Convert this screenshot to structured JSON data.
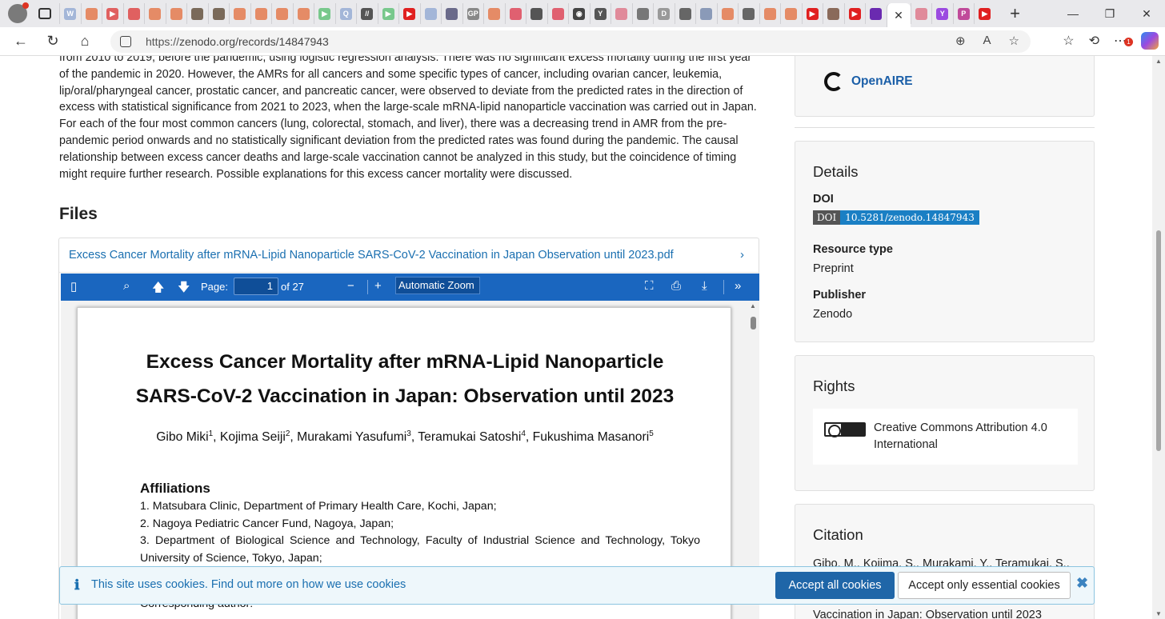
{
  "browser": {
    "tab_favicons": [
      {
        "color": "#a3b6d8",
        "glyph": "W"
      },
      {
        "color": "#e58b66",
        "glyph": ""
      },
      {
        "color": "#e06060",
        "glyph": "▶"
      },
      {
        "color": "#e06060",
        "glyph": ""
      },
      {
        "color": "#e58b66",
        "glyph": ""
      },
      {
        "color": "#e58b66",
        "glyph": ""
      },
      {
        "color": "#7a6a5a",
        "glyph": ""
      },
      {
        "color": "#7a6a5a",
        "glyph": ""
      },
      {
        "color": "#e58b66",
        "glyph": ""
      },
      {
        "color": "#e58b66",
        "glyph": ""
      },
      {
        "color": "#e58b66",
        "glyph": ""
      },
      {
        "color": "#e58b66",
        "glyph": ""
      },
      {
        "color": "#78c88c",
        "glyph": "▶"
      },
      {
        "color": "#a3b6d8",
        "glyph": "Q"
      },
      {
        "color": "#555",
        "glyph": "//"
      },
      {
        "color": "#78c88c",
        "glyph": "▶"
      },
      {
        "color": "#e02020",
        "glyph": "▶"
      },
      {
        "color": "#a3b6d8",
        "glyph": ""
      },
      {
        "color": "#6a6a8a",
        "glyph": ""
      },
      {
        "color": "#888",
        "glyph": "GP"
      },
      {
        "color": "#e58b66",
        "glyph": ""
      },
      {
        "color": "#e06070",
        "glyph": ""
      },
      {
        "color": "#555",
        "glyph": ""
      },
      {
        "color": "#e06070",
        "glyph": ""
      },
      {
        "color": "#444",
        "glyph": "◉"
      },
      {
        "color": "#555",
        "glyph": "Y"
      },
      {
        "color": "#e08a9a",
        "glyph": ""
      },
      {
        "color": "#777",
        "glyph": ""
      },
      {
        "color": "#999",
        "glyph": "D"
      },
      {
        "color": "#666",
        "glyph": ""
      },
      {
        "color": "#8a9ab8",
        "glyph": ""
      },
      {
        "color": "#e58b66",
        "glyph": ""
      },
      {
        "color": "#666",
        "glyph": ""
      },
      {
        "color": "#e58b66",
        "glyph": ""
      },
      {
        "color": "#e58b66",
        "glyph": ""
      },
      {
        "color": "#e02020",
        "glyph": "▶"
      },
      {
        "color": "#8a6a5a",
        "glyph": ""
      },
      {
        "color": "#e02020",
        "glyph": "▶"
      },
      {
        "color": "#6a2ab0",
        "glyph": ""
      }
    ],
    "after_active_favicons": [
      {
        "color": "#e08a9a",
        "glyph": ""
      },
      {
        "color": "#9b4ae0",
        "glyph": "Y"
      },
      {
        "color": "#c04a9a",
        "glyph": "P"
      },
      {
        "color": "#e02020",
        "glyph": "▶"
      }
    ],
    "active_tab_close": "✕",
    "new_tab": "+",
    "url_protocol": "https://",
    "url_rest": "zenodo.org/records/14847943",
    "notification_badge": "1"
  },
  "abstract": {
    "text": "from 2010 to 2019, before the pandemic, using logistic regression analysis. There was no significant excess mortality during the first year of the pandemic in 2020. However, the AMRs for all cancers and some specific types of cancer, including ovarian cancer, leukemia, lip/oral/pharyngeal cancer, prostatic cancer, and pancreatic cancer, were observed to deviate from the predicted rates in the direction of excess with statistical significance from 2021 to 2023, when the large-scale mRNA-lipid nanoparticle vaccination was carried out in Japan. For each of the four most common cancers (lung, colorectal, stomach, and liver), there was a decreasing trend in AMR from the pre-pandemic period onwards and no statistically significant deviation from the predicted rates was found during the pandemic. The causal relationship between excess cancer deaths and large-scale vaccination cannot be analyzed in this study, but the coincidence of timing might require further research. Possible explanations for this excess cancer mortality were discussed."
  },
  "files": {
    "heading": "Files",
    "filename": "Excess Cancer Mortality after mRNA-Lipid Nanoparticle SARS-CoV-2 Vaccination in Japan Observation until 2023.pdf",
    "viewer": {
      "page_label": "Page:",
      "page_value": "1",
      "page_of": "of 27",
      "zoom_value": "Automatic Zoom"
    },
    "pdf": {
      "title_line1": "Excess Cancer Mortality after mRNA-Lipid Nanoparticle",
      "title_line2": "SARS-CoV-2 Vaccination in Japan: Observation until 2023",
      "authors": [
        {
          "name": "Gibo Miki",
          "sup": "1",
          "sep": ", "
        },
        {
          "name": "Kojima Seiji",
          "sup": "2",
          "sep": ", "
        },
        {
          "name": "Murakami Yasufumi",
          "sup": "3",
          "sep": ", "
        },
        {
          "name": "Teramukai Satoshi",
          "sup": "4",
          "sep": ", "
        },
        {
          "name": "Fukushima Masanori",
          "sup": "5",
          "sep": ""
        }
      ],
      "affiliations_heading": "Affiliations",
      "affiliations": [
        "1. Matsubara Clinic, Department of Primary Health Care, Kochi, Japan;",
        "2. Nagoya Pediatric Cancer Fund, Nagoya, Japan;",
        "3. Department of Biological Science and Technology, Faculty of Industrial Science and Technology, Tokyo",
        "University of Science, Tokyo, Japan;"
      ],
      "corresponding": "Corresponding author:"
    }
  },
  "sidebar": {
    "openaire_label": "OpenAIRE",
    "details": {
      "heading": "Details",
      "doi_label": "DOI",
      "doi_badge_left": "DOI",
      "doi_value": "10.5281/zenodo.14847943",
      "resource_type_label": "Resource type",
      "resource_type_value": "Preprint",
      "publisher_label": "Publisher",
      "publisher_value": "Zenodo"
    },
    "rights": {
      "heading": "Rights",
      "license": "Creative Commons Attribution 4.0 International"
    },
    "citation": {
      "heading": "Citation",
      "line1": "Gibo, M., Kojima, S., Murakami, Y., Teramukai, S.,",
      "line_last": "Vaccination in Japan: Observation until 2023"
    }
  },
  "cookies": {
    "message_prefix": "This site uses cookies. Find out more on ",
    "message_link": "how we use cookies",
    "accept_all": "Accept all cookies",
    "accept_essential": "Accept only essential cookies",
    "close": "✖"
  }
}
